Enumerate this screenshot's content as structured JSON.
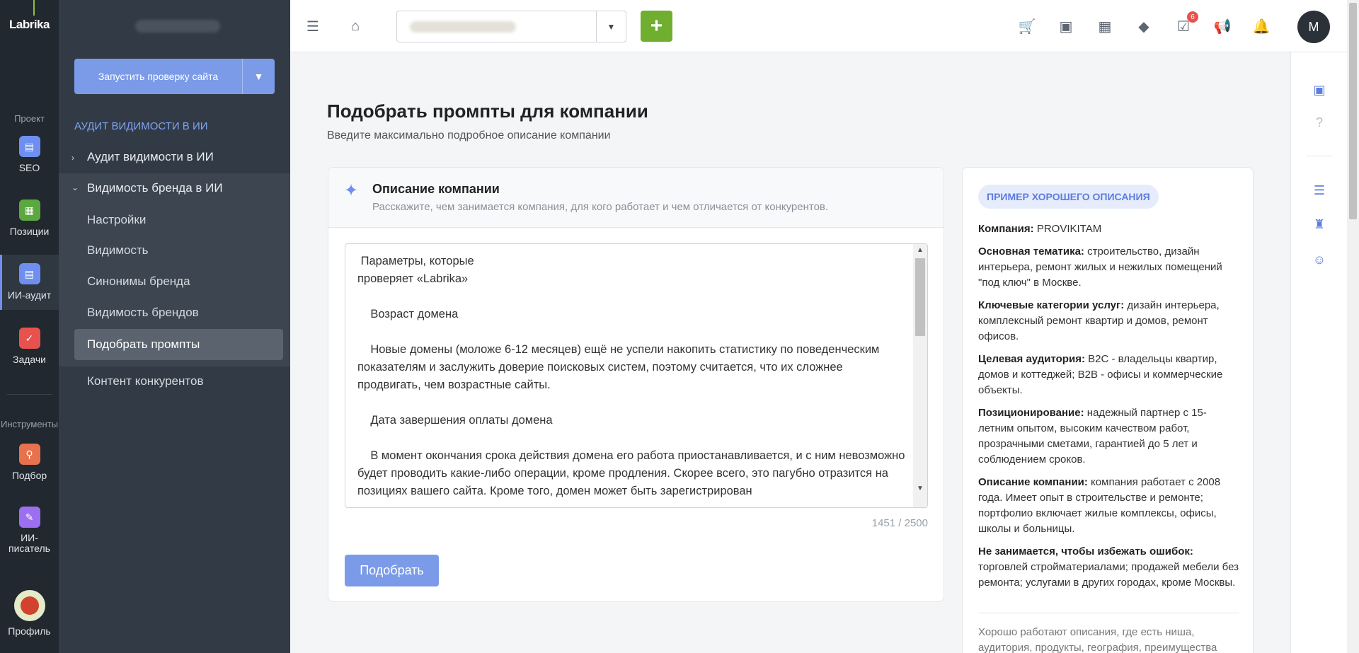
{
  "rail": {
    "logo": "Labrika",
    "section_project": "Проект",
    "section_tools": "Инструменты",
    "items": [
      {
        "label": "SEO",
        "color": "#6f8ff0"
      },
      {
        "label": "Позиции",
        "color": "#5ba841"
      },
      {
        "label": "ИИ-аудит",
        "color": "#6f8ff0"
      },
      {
        "label": "Задачи",
        "color": "#e8524e"
      },
      {
        "label": "Подбор",
        "color": "#e8714e"
      },
      {
        "label": "ИИ-писатель",
        "color": "#9b6ff0"
      },
      {
        "label": "Профиль",
        "color": "#d2432f"
      }
    ]
  },
  "sidebar": {
    "run_button": "Запустить проверку сайта",
    "heading": "АУДИТ ВИДИМОСТИ В ИИ",
    "nav": [
      {
        "label": "Аудит видимости в ИИ"
      },
      {
        "label": "Видимость бренда в ИИ"
      }
    ],
    "sub_items": [
      {
        "label": "Настройки"
      },
      {
        "label": "Видимость"
      },
      {
        "label": "Синонимы бренда"
      },
      {
        "label": "Видимость брендов"
      },
      {
        "label": "Подобрать промпты"
      }
    ],
    "bottom_item": "Контент конкурентов"
  },
  "topbar": {
    "add_label": "+",
    "tasks_badge": "6",
    "avatar": "M"
  },
  "page": {
    "title": "Подобрать промпты для компании",
    "subtitle": "Введите максимально подробное описание компании"
  },
  "card": {
    "title": "Описание компании",
    "subtitle": "Расскажите, чем занимается компания, для кого работает и чем отличается от конкурентов.",
    "textarea_value": " Параметры, которые\nпроверяет «Labrika»\n\n    Возраст домена\n\n    Новые домены (моложе 6-12 месяцев) ещё не успели накопить статистику по поведенческим показателям и заслужить доверие поисковых систем, поэтому считается, что их сложнее продвигать, чем возрастные сайты.\n\n    Дата завершения оплаты домена\n\n    В момент окончания срока действия домена его работа приостанавливается, и с ним невозможно будет проводить какие-либо операции, кроме продления. Скорее всего, это пагубно отразится на позициях вашего сайта. Кроме того, домен может быть зарегистрирован",
    "counter": "1451 / 2500",
    "submit": "Подобрать"
  },
  "example": {
    "badge": "ПРИМЕР ХОРОШЕГО ОПИСАНИЯ",
    "rows": [
      {
        "k": "Компания:",
        "v": " PROVIKITAM"
      },
      {
        "k": "Основная тематика:",
        "v": " строительство, дизайн интерьера, ремонт жилых и нежилых помещений \"под ключ\" в Москве."
      },
      {
        "k": "Ключевые категории услуг:",
        "v": " дизайн интерьера, комплексный ремонт квартир и домов, ремонт офисов."
      },
      {
        "k": "Целевая аудитория:",
        "v": " B2C - владельцы квартир, домов и коттеджей; B2B - офисы и коммерческие объекты."
      },
      {
        "k": "Позиционирование:",
        "v": " надежный партнер с 15-летним опытом, высоким качеством работ, прозрачными сметами, гарантией до 5 лет и соблюдением сроков."
      },
      {
        "k": "Описание компании:",
        "v": " компания работает с 2008 года. Имеет опыт в строительстве и ремонте; портфолио включает жилые комплексы, офисы, школы и больницы."
      },
      {
        "k": "Не занимается, чтобы избежать ошибок:",
        "v": " торговлей стройматериалами; продажей мебели без ремонта; услугами в других городах, кроме Москвы."
      }
    ],
    "footer": "Хорошо работают описания, где есть ниша, аудитория, продукты, география, преимущества"
  }
}
